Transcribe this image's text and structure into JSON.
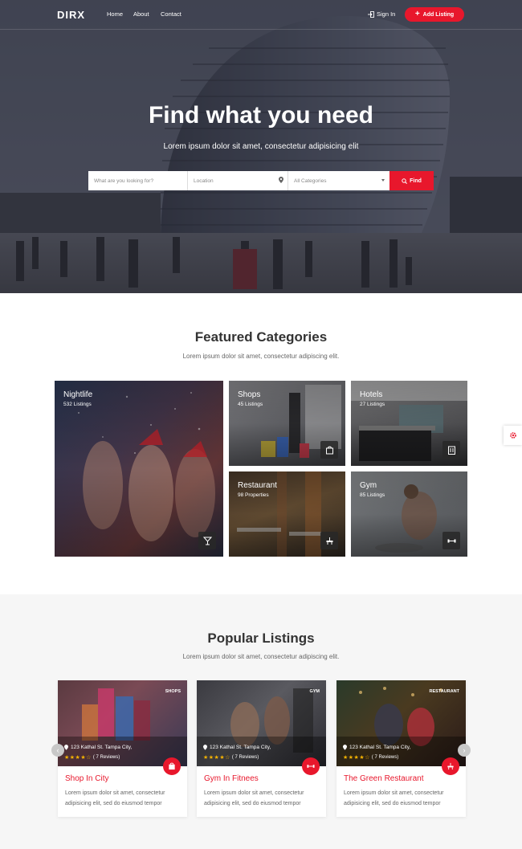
{
  "nav": {
    "logo": "DIRX",
    "links": [
      "Home",
      "About",
      "Contact"
    ],
    "signin": "Sign In",
    "add_listing": "Add Listing"
  },
  "hero": {
    "title": "Find what you need",
    "subtitle": "Lorem ipsum dolor sit amet, consectetur adipisicing elit",
    "search_placeholder": "What are you looking for?",
    "location_placeholder": "Location",
    "category_value": "All Categories",
    "find_label": "Find"
  },
  "featured": {
    "title": "Featured Categories",
    "subtitle": "Lorem ipsum dolor sit amet, consectetur adipiscing elit.",
    "categories": [
      {
        "name": "Nightlife",
        "count": "532 Listings",
        "icon": "cocktail-icon"
      },
      {
        "name": "Shops",
        "count": "45 Listings",
        "icon": "shopping-bag-icon"
      },
      {
        "name": "Hotels",
        "count": "27 Listings",
        "icon": "building-icon"
      },
      {
        "name": "Restaurant",
        "count": "98 Properties",
        "icon": "dining-icon"
      },
      {
        "name": "Gym",
        "count": "85 Listings",
        "icon": "dumbbell-icon"
      }
    ]
  },
  "popular": {
    "title": "Popular Listings",
    "subtitle": "Lorem ipsum dolor sit amet, consectetur adipiscing elit.",
    "listings": [
      {
        "tag": "SHOPS",
        "address": "123 Kathal St. Tampa City,",
        "stars": "★★★★☆",
        "reviews": "( 7 Reviews)",
        "title": "Shop In City",
        "desc": "Lorem ipsum dolor sit amet, consectetur adipisicing elit, sed do eiusmod tempor",
        "icon": "shopping-bag-icon"
      },
      {
        "tag": "GYM",
        "address": "123 Kathal St. Tampa City,",
        "stars": "★★★★☆",
        "reviews": "( 7 Reviews)",
        "title": "Gym In Fitnees",
        "desc": "Lorem ipsum dolor sit amet, consectetur adipisicing elit, sed do eiusmod tempor",
        "icon": "dumbbell-icon"
      },
      {
        "tag": "RESTAURANT",
        "address": "123 Kathal St. Tampa City,",
        "stars": "★★★★☆",
        "reviews": "( 7 Reviews)",
        "title": "The Green Restaurant",
        "desc": "Lorem ipsum dolor sit amet, consectetur adipisicing elit, sed do eiusmod tempor",
        "icon": "dining-icon"
      }
    ]
  },
  "colors": {
    "accent": "#e8172c",
    "star": "#f5b301"
  }
}
